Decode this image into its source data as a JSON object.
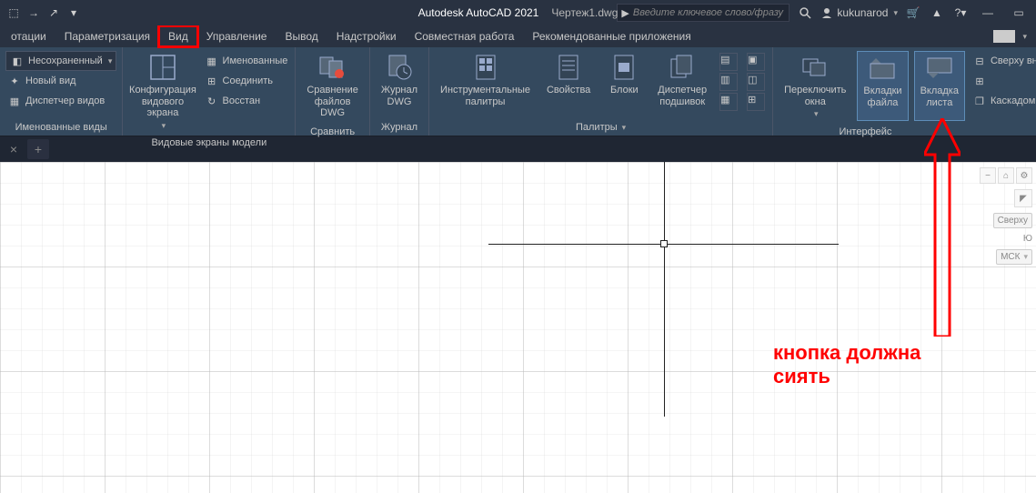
{
  "titlebar": {
    "app": "Autodesk AutoCAD 2021",
    "file": "Чертеж1.dwg",
    "search_placeholder": "Введите ключевое слово/фразу",
    "user": "kukunarod"
  },
  "menu": {
    "items": [
      "отации",
      "Параметризация",
      "Вид",
      "Управление",
      "Вывод",
      "Надстройки",
      "Совместная работа",
      "Рекомендованные приложения"
    ],
    "active_index": 2
  },
  "ribbon": {
    "p0": {
      "label": "Именованные виды",
      "unsaved": "Несохраненный",
      "new_view": "Новый вид",
      "view_mgr": "Диспетчер видов"
    },
    "p1": {
      "label": "Видовые экраны модели",
      "config": "Конфигурация\nвидового экрана",
      "named": "Именованные",
      "join": "Соединить",
      "restore": "Восстан"
    },
    "p2": {
      "label": "Сравнить",
      "btn": "Сравнение файлов\nDWG"
    },
    "p3": {
      "label": "Журнал",
      "btn": "Журнал\nDWG"
    },
    "p4": {
      "label": "Палитры",
      "tool": "Инструментальные\nпалитры",
      "props": "Свойства",
      "blocks": "Блоки",
      "sheet": "Диспетчер\nподшивок"
    },
    "p5": {
      "label": "Интерфейс",
      "switch": "Переключить\nокна",
      "file_tabs": "Вкладки\nфайла",
      "layout_tabs": "Вкладка\nлиста",
      "top": "Сверху вн",
      "cascade": "Каскадом"
    }
  },
  "rside": {
    "top": "Сверху",
    "wcs": "МСК",
    "south": "Ю"
  },
  "annotation": {
    "text1": "кнопка должна",
    "text2": "сиять"
  }
}
